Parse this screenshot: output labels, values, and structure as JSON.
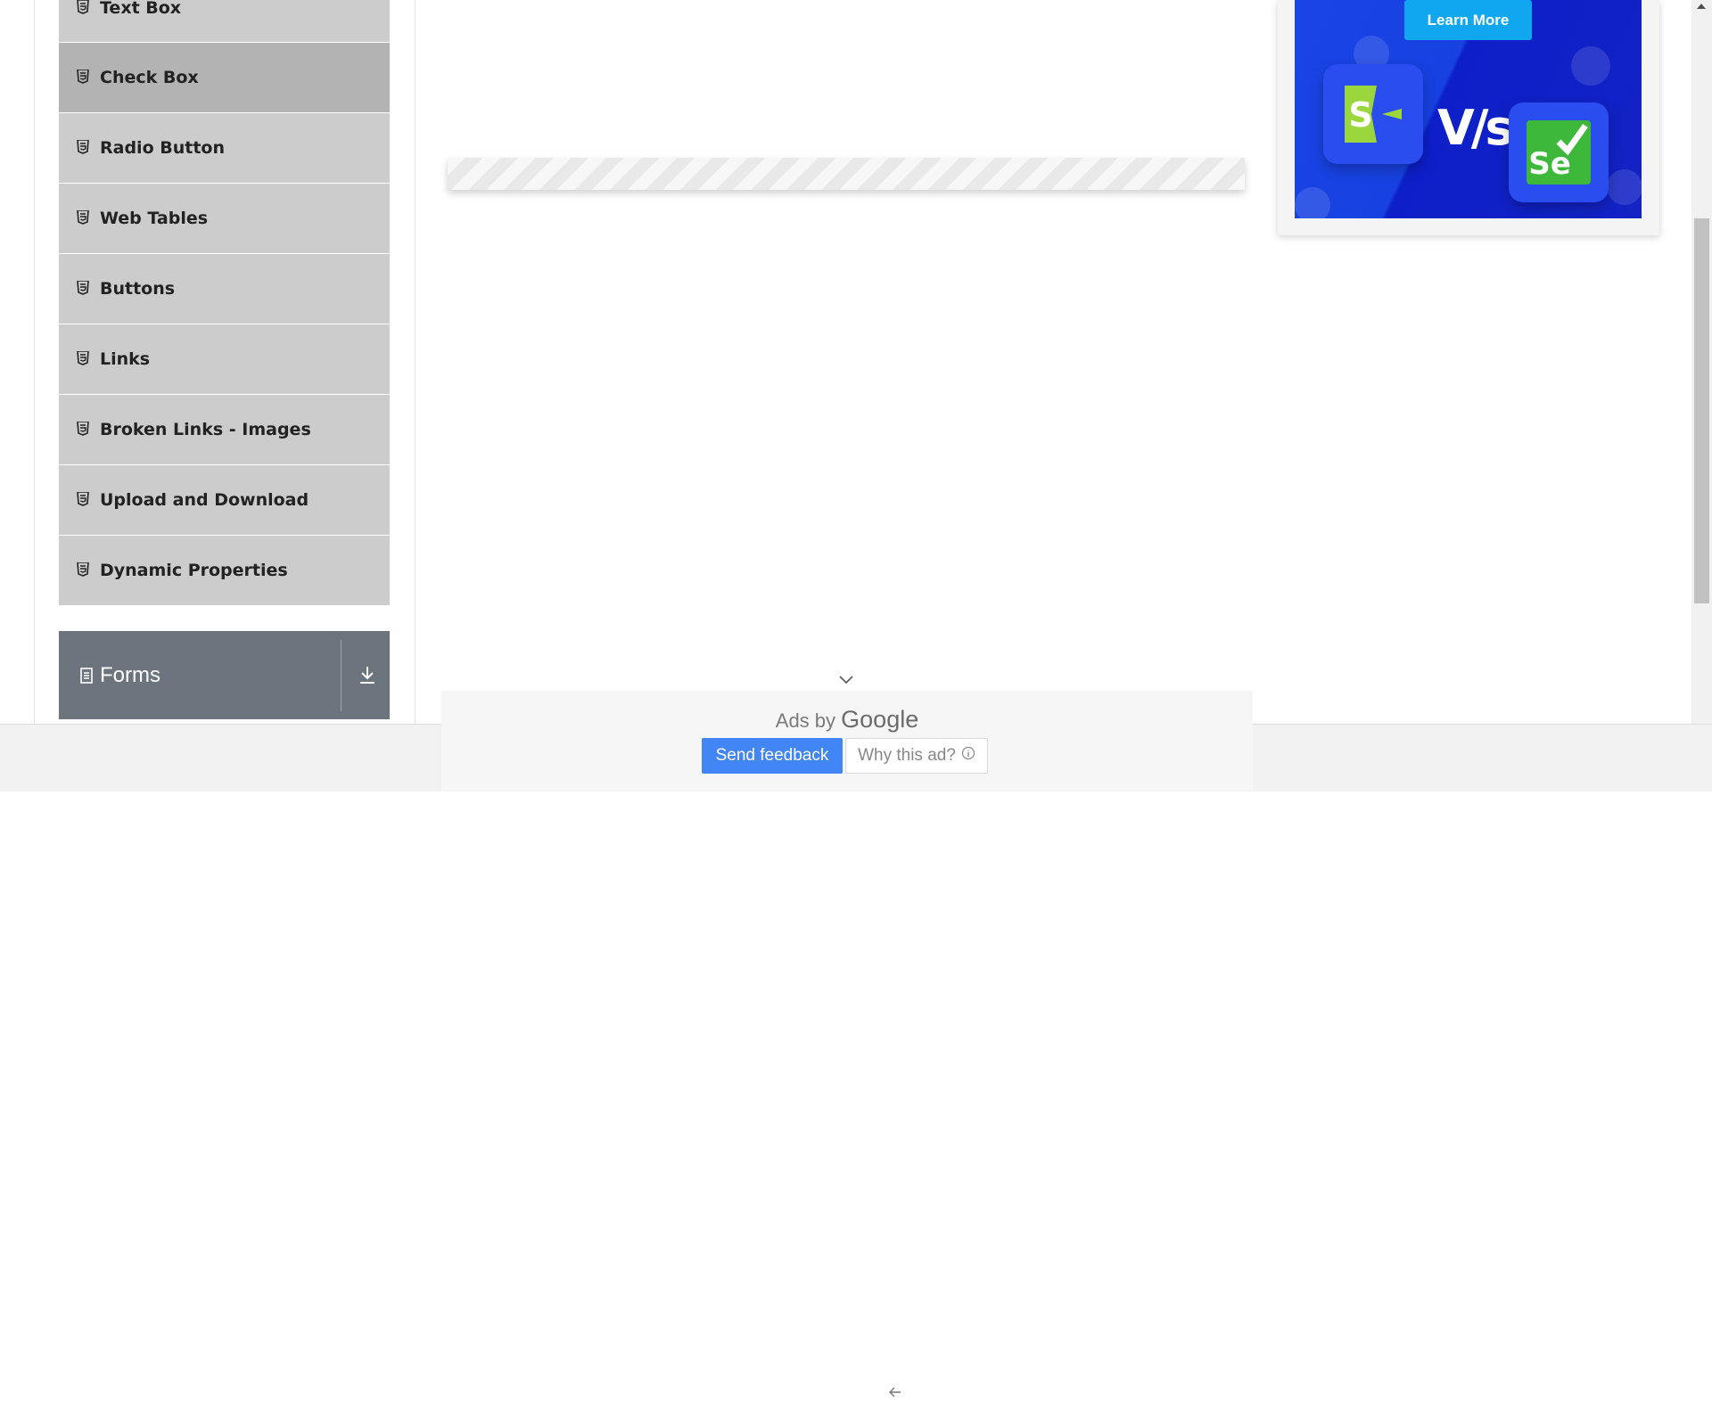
{
  "sidebar": {
    "items": [
      {
        "label": "Text Box",
        "icon": "html5-icon"
      },
      {
        "label": "Check Box",
        "icon": "html5-icon"
      },
      {
        "label": "Radio Button",
        "icon": "html5-icon"
      },
      {
        "label": "Web Tables",
        "icon": "html5-icon"
      },
      {
        "label": "Buttons",
        "icon": "html5-icon"
      },
      {
        "label": "Links",
        "icon": "html5-icon"
      },
      {
        "label": "Broken Links - Images",
        "icon": "html5-icon"
      },
      {
        "label": "Upload and Download",
        "icon": "html5-icon"
      },
      {
        "label": "Dynamic Properties",
        "icon": "html5-icon"
      }
    ],
    "group": {
      "label": "Forms",
      "icon": "document-icon",
      "action_icon": "download-icon"
    }
  },
  "ad": {
    "cta": "Learn More",
    "vs_text": "V/s",
    "logo_left_letter": "S",
    "logo_right_letter": "Se",
    "colors": {
      "ad_blue": "#1741e0",
      "cta": "#10a7f0",
      "logo_green": "#3db83a"
    }
  },
  "ads_footer": {
    "ads_by": "Ads by",
    "brand": "Google",
    "send_feedback": "Send feedback",
    "why_this_ad": "Why this ad?",
    "colors": {
      "send_feedback_bg": "#4285f4"
    }
  }
}
